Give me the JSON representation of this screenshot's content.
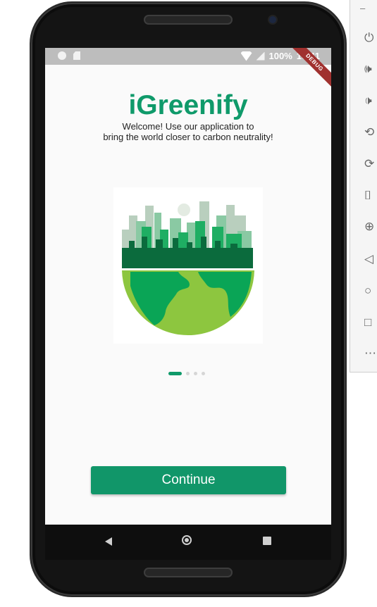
{
  "status_bar": {
    "battery": "100%",
    "time": "10:41",
    "debug_label": "DEBUG"
  },
  "app": {
    "title": "iGreenify",
    "welcome_line1": "Welcome! Use our application to",
    "welcome_line2": "bring the world closer to carbon neutrality!",
    "continue_label": "Continue",
    "page_indicator": {
      "pages": 4,
      "current": 1
    }
  },
  "emulator_toolbar": {
    "minimize": "–",
    "tools": [
      "power-icon",
      "volume-up-icon",
      "volume-down-icon",
      "rotate-left-icon",
      "rotate-right-icon",
      "camera-icon",
      "zoom-icon",
      "back-icon",
      "home-icon",
      "overview-icon",
      "more-icon"
    ]
  },
  "colors": {
    "brand_green": "#0f9a6a",
    "button_green": "#119669",
    "status_bar": "#bdbdbd",
    "debug_banner": "#a0312f"
  }
}
